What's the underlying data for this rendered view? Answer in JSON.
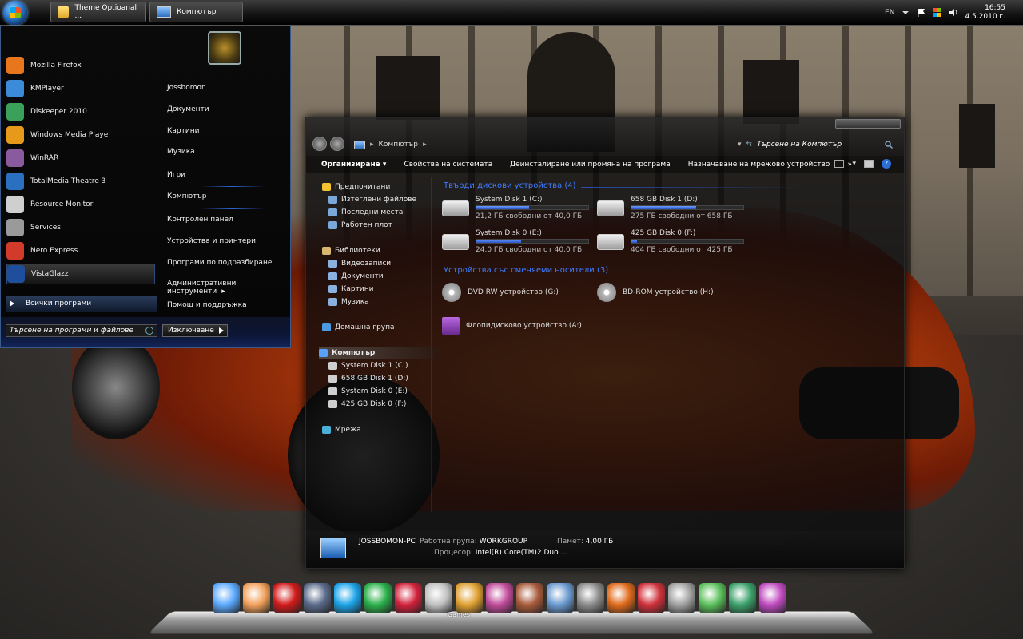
{
  "taskbar": {
    "start_orb": "windows-orb",
    "tasks": [
      {
        "label": "Theme Optioanal ...",
        "icon": "folder-icon"
      },
      {
        "label": "Компютър",
        "icon": "computer-icon"
      }
    ],
    "tray": {
      "language": "EN",
      "icons": [
        "chevron-down-icon",
        "flag-icon",
        "network-icon",
        "volume-icon"
      ],
      "time": "16:55",
      "date": "4.5.2010 г."
    }
  },
  "start_menu": {
    "programs": [
      {
        "label": "Mozilla Firefox",
        "color": "#e8761c"
      },
      {
        "label": "KMPlayer",
        "color": "#3b8bd8"
      },
      {
        "label": "Diskeeper 2010",
        "color": "#3aa05a"
      },
      {
        "label": "Windows Media Player",
        "color": "#e79a1a"
      },
      {
        "label": "WinRAR",
        "color": "#8a5a9e"
      },
      {
        "label": "TotalMedia Theatre 3",
        "color": "#2a6fc0"
      },
      {
        "label": "Resource Monitor",
        "color": "#cfcfcf"
      },
      {
        "label": "Services",
        "color": "#9a9a9a"
      },
      {
        "label": "Nero Express",
        "color": "#d23a2a"
      },
      {
        "label": "VistaGlazz",
        "color": "#1f4f9c"
      }
    ],
    "all_programs": "Всички програми",
    "search_placeholder": "Търсене на програми и файлове",
    "shutdown_label": "Изключване",
    "links": [
      {
        "label": "Jossbomon"
      },
      {
        "label": "Документи"
      },
      {
        "label": "Картини"
      },
      {
        "label": "Музика"
      },
      {
        "label": "Игри"
      },
      {
        "label": "Компютър"
      },
      {
        "label": "Контролен панел"
      },
      {
        "label": "Устройства и принтери"
      },
      {
        "label": "Програми по подразбиране"
      },
      {
        "label": "Административни инструменти"
      },
      {
        "label": "Помощ и поддръжка"
      }
    ],
    "links_arrow": "▸"
  },
  "explorer": {
    "address": "Компютър",
    "search_placeholder": "Търсене на Компютър",
    "commands": [
      {
        "label": "Организиране"
      },
      {
        "label": "Свойства на системата"
      },
      {
        "label": "Деинсталиране или промяна на програма"
      },
      {
        "label": "Назначаване на мрежово устройство"
      },
      {
        "label": "»"
      }
    ],
    "nav": {
      "favorites": {
        "label": "Предпочитани",
        "items": [
          "Изтеглени файлове",
          "Последни места",
          "Работен плот"
        ]
      },
      "libraries": {
        "label": "Библиотеки",
        "items": [
          "Видеозаписи",
          "Документи",
          "Картини",
          "Музика"
        ]
      },
      "homegroup": "Домашна група",
      "computer": {
        "label": "Компютър",
        "items": [
          "System Disk 1 (C:)",
          "658 GB Disk 1 (D:)",
          "System Disk 0 (E:)",
          "425 GB Disk 0 (F:)"
        ]
      },
      "network": "Мрежа"
    },
    "hdd_group": "Твърди дискови устройства (4)",
    "drives": [
      {
        "name": "System Disk 1 (C:)",
        "free": "21,2 ГБ свободни от 40,0 ГБ",
        "used_fraction": 0.47
      },
      {
        "name": "658 GB Disk 1 (D:)",
        "free": "275 ГБ свободни от 658 ГБ",
        "used_fraction": 0.58
      },
      {
        "name": "System Disk 0 (E:)",
        "free": "24,0 ГБ свободни от 40,0 ГБ",
        "used_fraction": 0.4
      },
      {
        "name": "425 GB Disk 0 (F:)",
        "free": "404 ГБ свободни от 425 ГБ",
        "used_fraction": 0.05
      }
    ],
    "removable_group": "Устройства със сменяеми носители (3)",
    "removable": [
      {
        "name": "DVD RW устройство (G:)",
        "icon": "dvd-icon"
      },
      {
        "name": "BD-ROM устройство (H:)",
        "icon": "bd-icon"
      },
      {
        "name": "Флопидисково устройство (A:)",
        "icon": "floppy-icon"
      }
    ],
    "details": {
      "computer_name": "JOSSBOMON-PC",
      "workgroup_label": "Работна група:",
      "workgroup": "WORKGROUP",
      "memory_label": "Памет:",
      "memory": "4,00 ГБ",
      "cpu_label": "Процесор:",
      "cpu": "Intel(R) Core(TM)2 Duo ..."
    }
  },
  "dock": {
    "icons": [
      {
        "name": "computer-icon",
        "color": "#5aa9ff"
      },
      {
        "name": "gimp-icon",
        "color": "#f2a05a"
      },
      {
        "name": "opera-icon",
        "color": "#d21a1a"
      },
      {
        "name": "steam-icon",
        "color": "#5a6a8a"
      },
      {
        "name": "skype-icon",
        "color": "#1aa3e8"
      },
      {
        "name": "media-icon",
        "color": "#2ab04a"
      },
      {
        "name": "heart-icon",
        "color": "#d2203a"
      },
      {
        "name": "games-icon",
        "color": "#c0c0c0"
      },
      {
        "name": "photo-icon",
        "color": "#e0a030"
      },
      {
        "name": "paint-icon",
        "color": "#c04a9a"
      },
      {
        "name": "image-icon",
        "color": "#a85a3a"
      },
      {
        "name": "avatar-icon",
        "color": "#6a9ad0"
      },
      {
        "name": "camera-icon",
        "color": "#8a8a8a"
      },
      {
        "name": "cube-icon",
        "color": "#e06a1a"
      },
      {
        "name": "calendar-icon",
        "color": "#d0303a"
      },
      {
        "name": "tools-icon",
        "color": "#a0a0a0"
      },
      {
        "name": "monitor-icon",
        "color": "#5ac05a"
      },
      {
        "name": "recycle-icon",
        "color": "#3aa06a"
      },
      {
        "name": "ccleaner-icon",
        "color": "#c04ac0"
      }
    ],
    "games_label": "Games"
  }
}
